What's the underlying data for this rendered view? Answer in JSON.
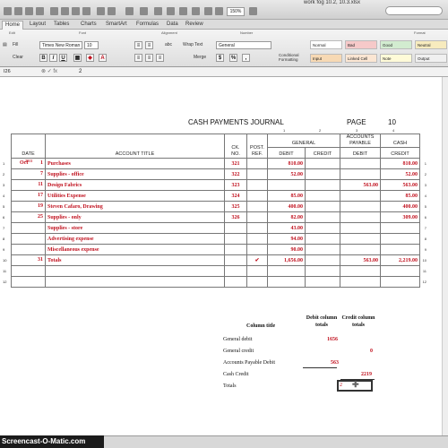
{
  "window": {
    "filename": "work fog 10.2, 10.3.xlsx",
    "zoom": "150%"
  },
  "ribbon_tabs": [
    "Home",
    "Layout",
    "Tables",
    "Charts",
    "SmartArt",
    "Formulas",
    "Data",
    "Review"
  ],
  "ribbon": {
    "groups": {
      "edit": "Edit",
      "font": "Font",
      "alignment": "Alignment",
      "number": "Number",
      "format": "Format"
    },
    "fill_label": "Fill",
    "clear_label": "Clear",
    "font_name": "Times New Roman",
    "font_size": "10",
    "bold": "B",
    "italic": "I",
    "underline": "U",
    "wrap_text": "Wrap Text",
    "merge": "Merge",
    "number_format": "General",
    "abc_label": "abc",
    "conditional_formatting": "Conditional Formatting",
    "styles": [
      "Normal",
      "Bad",
      "Good",
      "Neutral",
      "Input",
      "Linked Cell",
      "Note",
      "Output"
    ]
  },
  "formula_bar": {
    "cell_ref": "I26",
    "value": "2"
  },
  "journal": {
    "title": "CASH PAYMENTS JOURNAL",
    "page_label": "PAGE",
    "page_number": "10",
    "col_numbers": [
      "1",
      "2",
      "3",
      "4"
    ],
    "headers": {
      "date": "DATE",
      "account": "ACCOUNT TITLE",
      "ck_no": "CK. NO.",
      "post_ref": "POST. REF.",
      "general": "GENERAL",
      "debit": "DEBIT",
      "credit": "CREDIT",
      "ap_top": "ACCOUNTS PAYABLE",
      "ap_debit": "DEBIT",
      "cash_top": "CASH",
      "cash_credit": "CREDIT",
      "year": "2013"
    },
    "rows": [
      {
        "num": "1",
        "month": "Oct",
        "day": "1",
        "account": "Purchases",
        "ck": "321",
        "post": "",
        "gen_debit": "810.00",
        "gen_credit": "",
        "ap_debit": "",
        "cash_credit": "810.00"
      },
      {
        "num": "2",
        "month": "",
        "day": "7",
        "account": "Supplies - office",
        "ck": "322",
        "post": "",
        "gen_debit": "52.00",
        "gen_credit": "",
        "ap_debit": "",
        "cash_credit": "52.00"
      },
      {
        "num": "3",
        "month": "",
        "day": "11",
        "account": "Design Fabrics",
        "ck": "323",
        "post": "",
        "gen_debit": "",
        "gen_credit": "",
        "ap_debit": "563.00",
        "cash_credit": "563.00"
      },
      {
        "num": "4",
        "month": "",
        "day": "17",
        "account": "Utilities Expense",
        "ck": "324",
        "post": "",
        "gen_debit": "85.00",
        "gen_credit": "",
        "ap_debit": "",
        "cash_credit": "85.00"
      },
      {
        "num": "5",
        "month": "",
        "day": "19",
        "account": "Steven Cafaro, Drawing",
        "ck": "325",
        "post": "",
        "gen_debit": "400.00",
        "gen_credit": "",
        "ap_debit": "",
        "cash_credit": "400.00"
      },
      {
        "num": "6",
        "month": "",
        "day": "25",
        "account": "Supplies - only",
        "ck": "326",
        "post": "",
        "gen_debit": "82.00",
        "gen_credit": "",
        "ap_debit": "",
        "cash_credit": "309.00"
      },
      {
        "num": "7",
        "month": "",
        "day": "",
        "account": "Supplies - store",
        "ck": "",
        "post": "",
        "gen_debit": "43.00",
        "gen_credit": "",
        "ap_debit": "",
        "cash_credit": ""
      },
      {
        "num": "8",
        "month": "",
        "day": "",
        "account": "Advertising expense",
        "ck": "",
        "post": "",
        "gen_debit": "94.00",
        "gen_credit": "",
        "ap_debit": "",
        "cash_credit": ""
      },
      {
        "num": "9",
        "month": "",
        "day": "",
        "account": "Miscellaneous expense",
        "ck": "",
        "post": "",
        "gen_debit": "90.00",
        "gen_credit": "",
        "ap_debit": "",
        "cash_credit": ""
      },
      {
        "num": "10",
        "month": "",
        "day": "31",
        "account": "Totals",
        "ck": "",
        "post": "✔",
        "gen_debit": "1,656.00",
        "gen_credit": "",
        "ap_debit": "563.00",
        "cash_credit": "2,219.00"
      },
      {
        "num": "11",
        "month": "",
        "day": "",
        "account": "",
        "ck": "",
        "post": "",
        "gen_debit": "",
        "gen_credit": "",
        "ap_debit": "",
        "cash_credit": ""
      },
      {
        "num": "12",
        "month": "",
        "day": "",
        "account": "",
        "ck": "",
        "post": "",
        "gen_debit": "",
        "gen_credit": "",
        "ap_debit": "",
        "cash_credit": ""
      }
    ]
  },
  "summary": {
    "col_title": "Column title",
    "debit_head": "Debit column totals",
    "credit_head": "Credit column totals",
    "rows": [
      {
        "label": "General debit",
        "debit": "1656",
        "credit": ""
      },
      {
        "label": "General credit",
        "debit": "",
        "credit": "0"
      },
      {
        "label": "Accounts Payable Debit",
        "debit": "563",
        "credit": ""
      },
      {
        "label": "Cash Credit",
        "debit": "",
        "credit": "2219"
      },
      {
        "label": "Totals",
        "debit": "",
        "credit": "2"
      }
    ]
  },
  "watermark": "Screencast-O-Matic.com"
}
